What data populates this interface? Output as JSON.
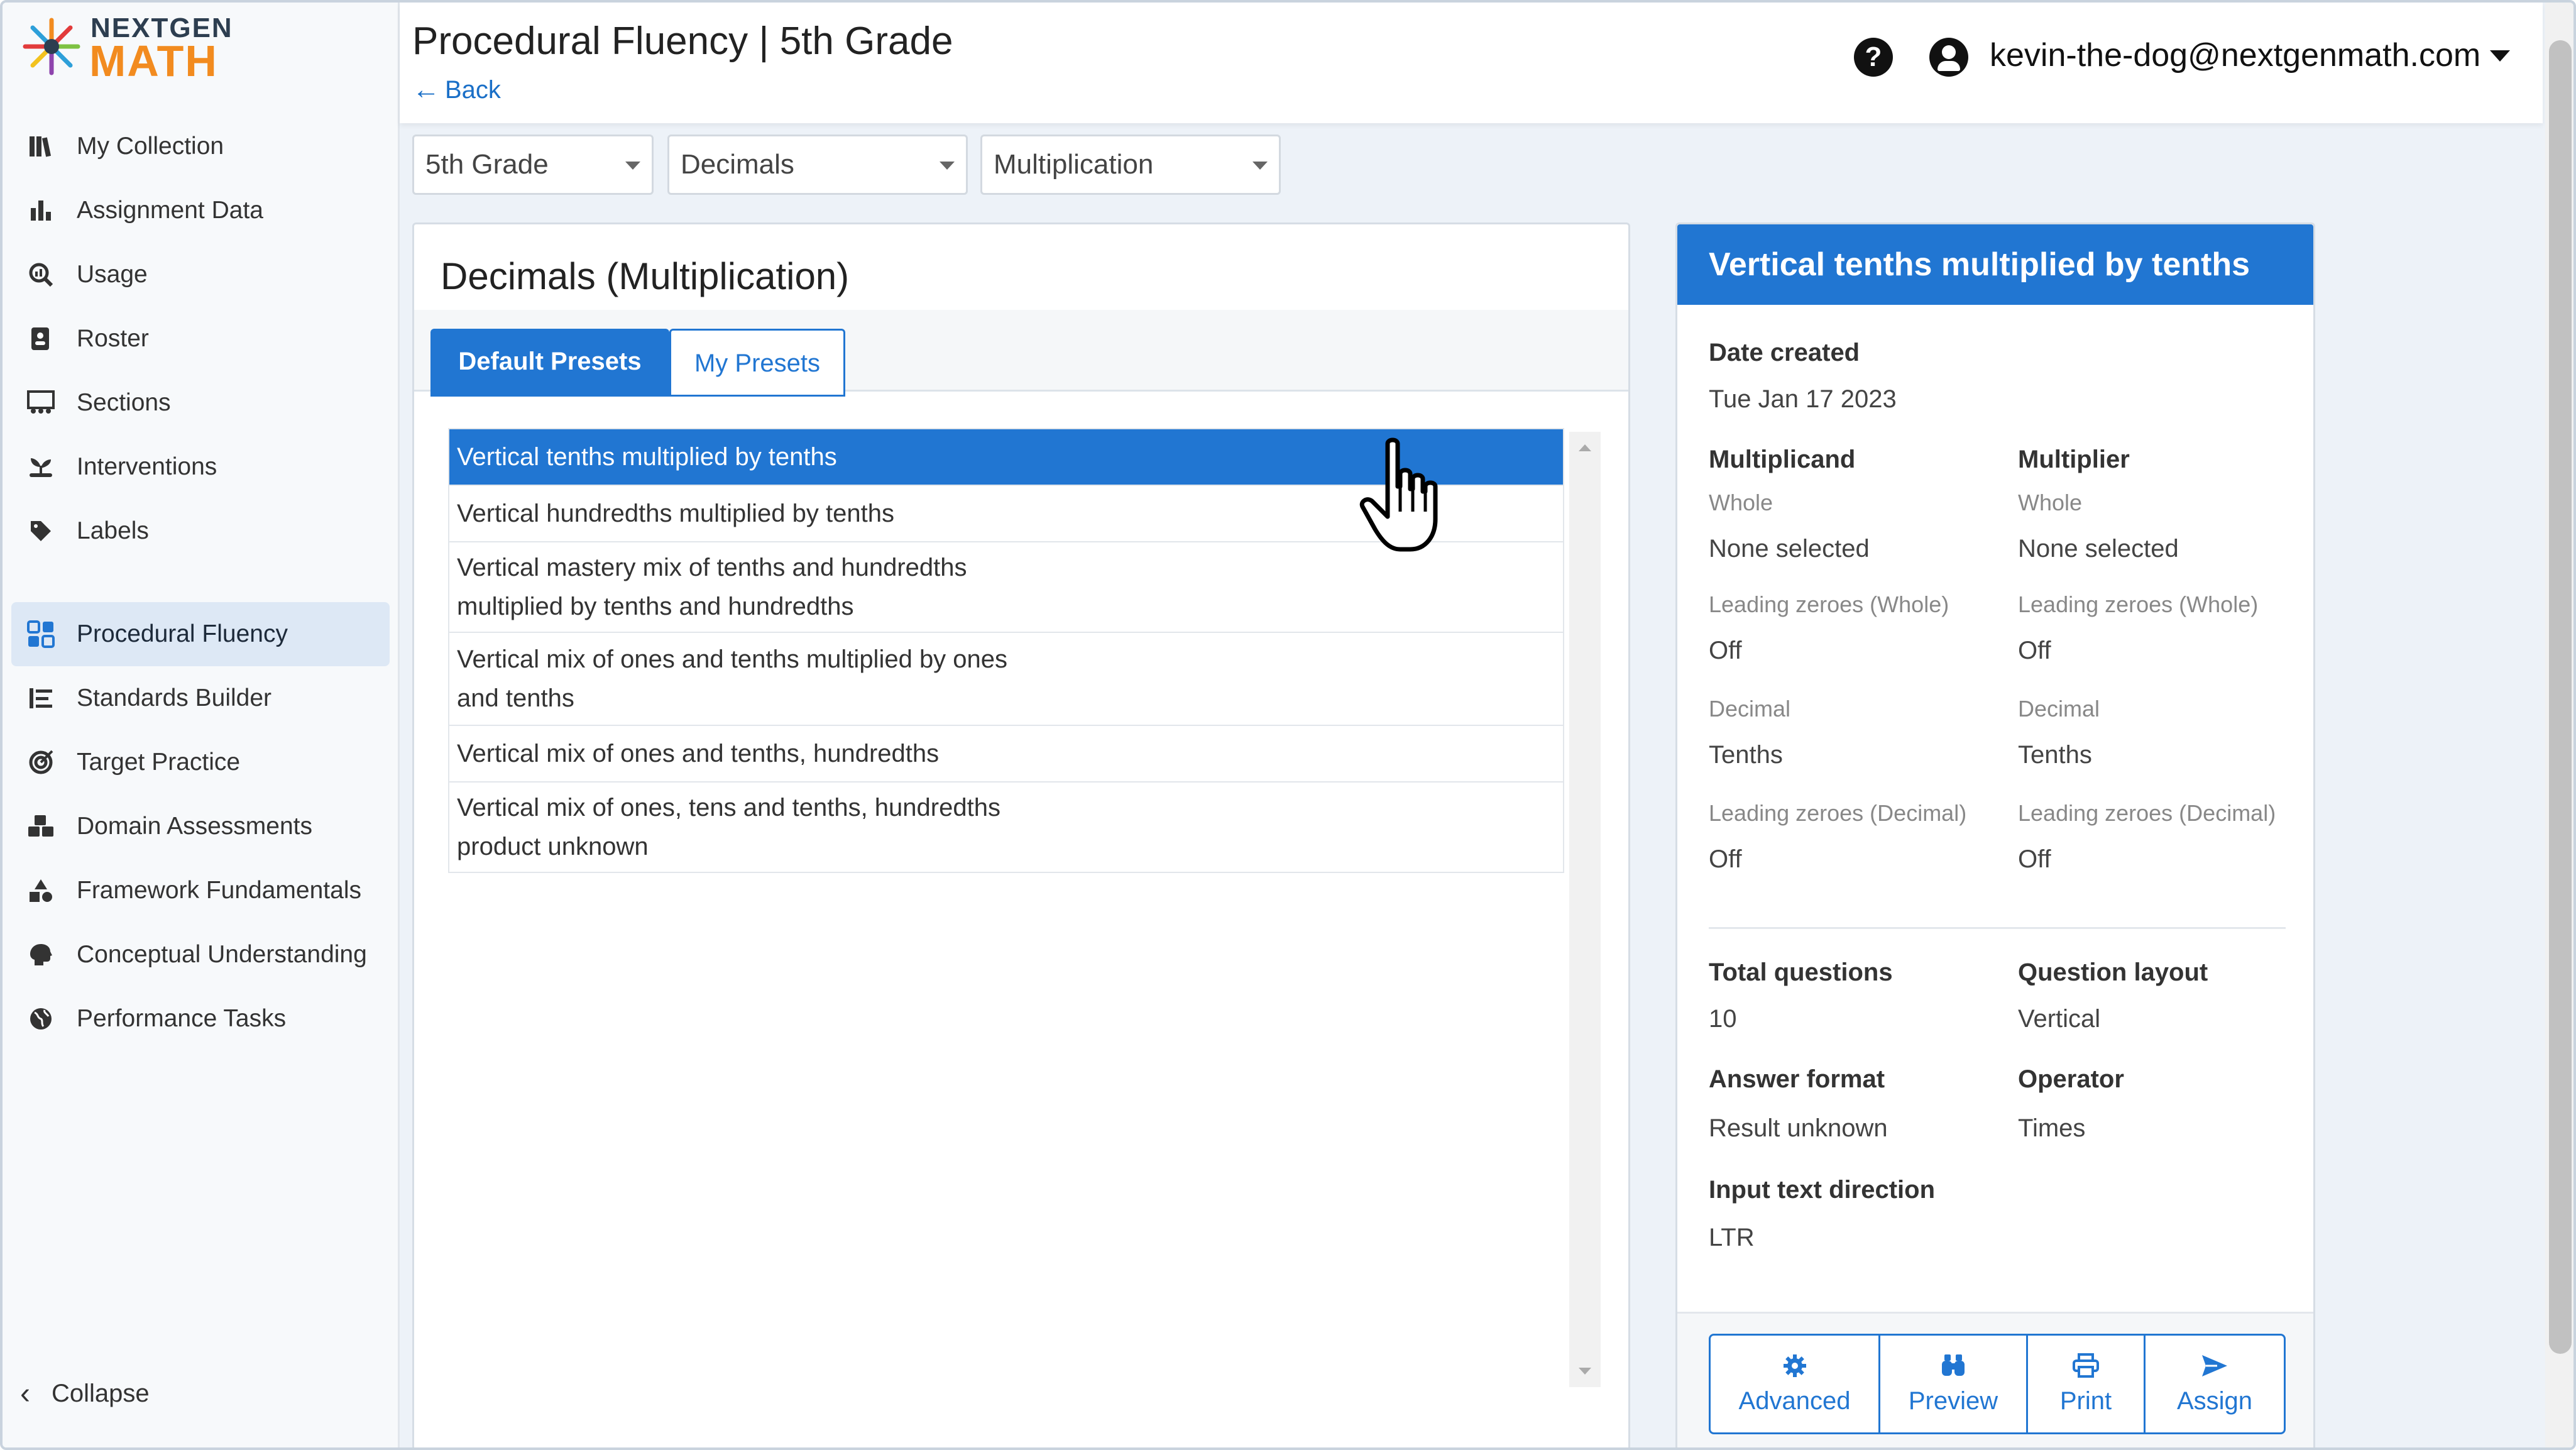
{
  "app": {
    "logo_top": "NEXTGEN",
    "logo_bottom": "MATH",
    "page_title": "Procedural Fluency | 5th Grade",
    "back_label": "Back"
  },
  "user": {
    "help_label": "?",
    "email": "kevin-the-dog@nextgenmath.com"
  },
  "sidebar": {
    "group1": [
      {
        "label": "My Collection",
        "icon": "books-icon"
      },
      {
        "label": "Assignment Data",
        "icon": "bar-chart-icon"
      },
      {
        "label": "Usage",
        "icon": "magnify-chart-icon"
      },
      {
        "label": "Roster",
        "icon": "contact-card-icon"
      },
      {
        "label": "Sections",
        "icon": "classroom-icon"
      },
      {
        "label": "Interventions",
        "icon": "seedling-hand-icon"
      },
      {
        "label": "Labels",
        "icon": "tag-icon"
      }
    ],
    "group2": [
      {
        "label": "Procedural Fluency",
        "icon": "grid-apps-icon",
        "active": true
      },
      {
        "label": "Standards Builder",
        "icon": "list-tree-icon"
      },
      {
        "label": "Target Practice",
        "icon": "target-icon"
      },
      {
        "label": "Domain Assessments",
        "icon": "cubes-icon"
      },
      {
        "label": "Framework Fundamentals",
        "icon": "shapes-icon"
      },
      {
        "label": "Conceptual Understanding",
        "icon": "brain-icon"
      },
      {
        "label": "Performance Tasks",
        "icon": "globe-icon"
      }
    ],
    "collapse_label": "Collapse"
  },
  "filters": {
    "grade": "5th Grade",
    "domain": "Decimals",
    "operation": "Multiplication"
  },
  "presets": {
    "title": "Decimals (Multiplication)",
    "tab_default": "Default Presets",
    "tab_mine": "My Presets",
    "items": [
      {
        "lines": [
          "Vertical tenths multiplied by tenths"
        ],
        "selected": true
      },
      {
        "lines": [
          "Vertical hundredths multiplied by tenths"
        ]
      },
      {
        "lines": [
          "Vertical mastery mix of tenths and hundredths",
          "multiplied by tenths and hundredths"
        ]
      },
      {
        "lines": [
          "Vertical mix of ones and tenths multiplied by ones",
          "and tenths"
        ]
      },
      {
        "lines": [
          "Vertical mix of ones and tenths, hundredths"
        ]
      },
      {
        "lines": [
          "Vertical mix of ones, tens and tenths, hundredths",
          "product unknown"
        ]
      }
    ]
  },
  "detail": {
    "title": "Vertical tenths multiplied by tenths",
    "date_created_label": "Date created",
    "date_created": "Tue Jan 17 2023",
    "multiplicand": {
      "label": "Multiplicand",
      "whole_label": "Whole",
      "whole_value": "None selected",
      "lz_whole_label": "Leading zeroes (Whole)",
      "lz_whole_value": "Off",
      "decimal_label": "Decimal",
      "decimal_value": "Tenths",
      "lz_decimal_label": "Leading zeroes (Decimal)",
      "lz_decimal_value": "Off"
    },
    "multiplier": {
      "label": "Multiplier",
      "whole_label": "Whole",
      "whole_value": "None selected",
      "lz_whole_label": "Leading zeroes (Whole)",
      "lz_whole_value": "Off",
      "decimal_label": "Decimal",
      "decimal_value": "Tenths",
      "lz_decimal_label": "Leading zeroes (Decimal)",
      "lz_decimal_value": "Off"
    },
    "total_questions_label": "Total questions",
    "total_questions": "10",
    "question_layout_label": "Question layout",
    "question_layout": "Vertical",
    "answer_format_label": "Answer format",
    "answer_format": "Result unknown",
    "operator_label": "Operator",
    "operator": "Times",
    "input_direction_label": "Input text direction",
    "input_direction": "LTR"
  },
  "actions": {
    "advanced": "Advanced",
    "preview": "Preview",
    "print": "Print",
    "assign": "Assign"
  },
  "colors": {
    "primary": "#2176d2",
    "logo_orange": "#f28b1f",
    "logo_dark": "#2d3e50",
    "sidebar_active": "#dde8f5"
  }
}
